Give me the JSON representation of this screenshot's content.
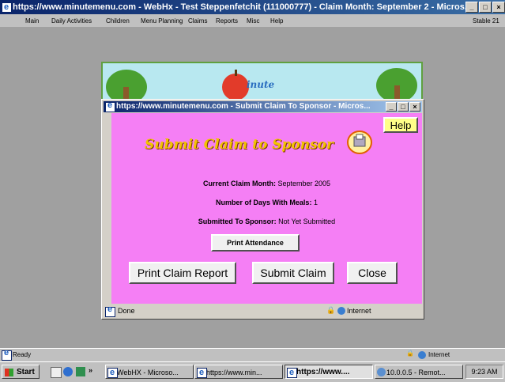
{
  "browser": {
    "title": "https://www.minutemenu.com - WebHx - Test Steppenfetchit (111000777) - Claim Month: September 2 - Micros...",
    "menu": [
      "Main",
      "Daily Activities",
      "Children",
      "Menu Planning",
      "Claims",
      "Reports",
      "Misc",
      "Help"
    ],
    "menu_right": "Stable 21",
    "status_left": "Ready",
    "status_right": "Internet"
  },
  "banner": {
    "logo_text": "inute"
  },
  "popup": {
    "title": "https://www.minutemenu.com - Submit Claim To Sponsor - Micros...",
    "help_label": "Help",
    "heading": "Submit Claim to Sponsor",
    "lines": [
      {
        "label": "Current Claim Month:",
        "value": "September 2005"
      },
      {
        "label": "Number of Days With Meals:",
        "value": "1"
      },
      {
        "label": "Submitted To Sponsor:",
        "value": "Not Yet Submitted"
      }
    ],
    "print_attendance_label": "Print Attendance",
    "print_claim_report_label": "Print Claim Report",
    "submit_claim_label": "Submit Claim",
    "close_label": "Close",
    "status_left": "Done",
    "status_right": "Internet"
  },
  "taskbar": {
    "start_label": "Start",
    "buttons": [
      {
        "label": "WebHX - Microso..."
      },
      {
        "label": "https://www.min..."
      },
      {
        "label": "https://www...."
      },
      {
        "label": "10.0.0.5 - Remot..."
      }
    ],
    "clock": "9:23 AM"
  },
  "colors": {
    "popup_bg": "#f57ff5",
    "titlebar": "#0a246a"
  }
}
